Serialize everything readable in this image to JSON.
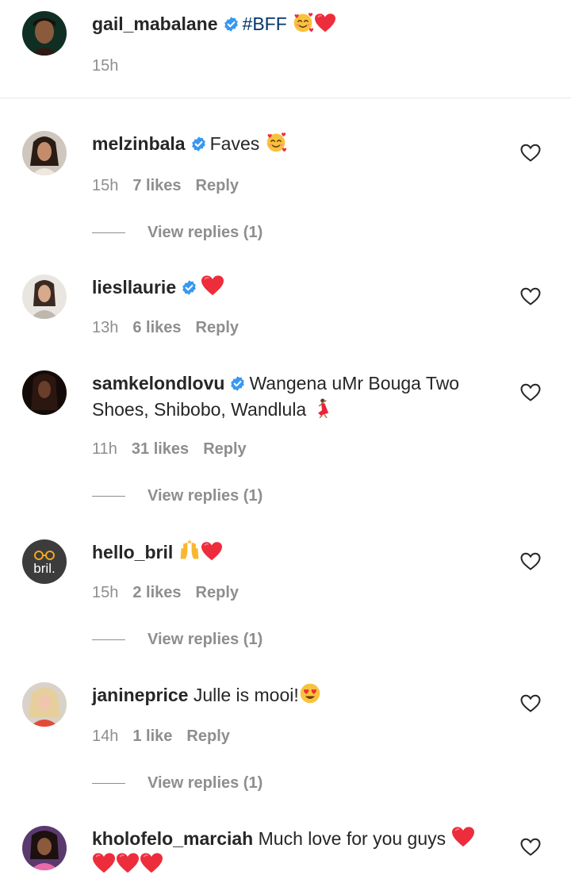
{
  "caption": {
    "username": "gail_mabalane",
    "text": "#BFF",
    "time": "15h",
    "emojis": [
      "smiling-face-with-hearts",
      "red-heart"
    ]
  },
  "comments": [
    {
      "username": "melzinbala",
      "verified": true,
      "text": "Faves",
      "time": "15h",
      "likes": "7 likes",
      "reply": "Reply",
      "view_replies": "View replies (1)",
      "emojis": [
        "smiling-face-with-hearts"
      ]
    },
    {
      "username": "liesllaurie",
      "verified": true,
      "text": "",
      "time": "13h",
      "likes": "6 likes",
      "reply": "Reply",
      "emojis": [
        "red-heart"
      ]
    },
    {
      "username": "samkelondlovu",
      "verified": true,
      "text": "Wangena uMr Bouga Two",
      "text2": "Shoes, Shibobo, Wandlula",
      "time": "11h",
      "likes": "31 likes",
      "reply": "Reply",
      "view_replies": "View replies (1)",
      "emojis": [
        "dancing-woman"
      ]
    },
    {
      "username": "hello_bril",
      "verified": false,
      "text": "",
      "time": "15h",
      "likes": "2 likes",
      "reply": "Reply",
      "view_replies": "View replies (1)",
      "avatar_text": "bril.",
      "emojis": [
        "raising-hands",
        "red-heart"
      ]
    },
    {
      "username": "janineprice",
      "verified": false,
      "text": "Julle is mooi!",
      "time": "14h",
      "likes": "1 like",
      "reply": "Reply",
      "view_replies": "View replies (1)",
      "emojis": [
        "heart-eyes"
      ]
    },
    {
      "username": "kholofelo_marciah",
      "verified": false,
      "text": "Much love for you guys",
      "emojis": [
        "red-heart",
        "red-heart",
        "red-heart",
        "red-heart"
      ]
    }
  ],
  "colors": {
    "text": "#262626",
    "meta": "#8e8e8e",
    "verified": "#3897f0",
    "heart": "#ed2d3b"
  }
}
